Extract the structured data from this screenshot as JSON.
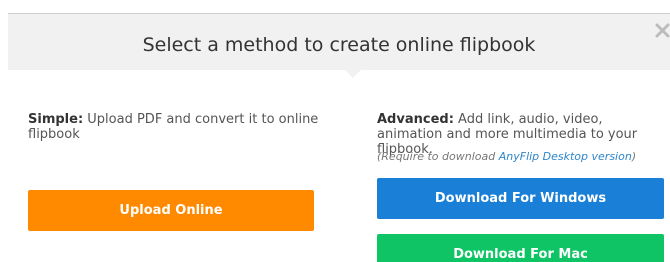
{
  "dialog": {
    "title": "Select a method to create online flipbook"
  },
  "simple": {
    "label": "Simple:",
    "text": " Upload PDF and convert it to online flipbook",
    "button_label": "Upload Online",
    "button_color": "#ff8a00"
  },
  "advanced": {
    "label": "Advanced:",
    "text": " Add link, audio, video, animation and more multimedia to your flipbook.",
    "note_prefix": "(Require to download ",
    "note_link": "AnyFlip Desktop version",
    "note_suffix": ")",
    "windows_button_label": "Download For Windows",
    "windows_button_color": "#1a7fd6",
    "mac_button_label": "Download For Mac",
    "mac_button_color": "#0ec464"
  },
  "icons": {
    "close": "close-icon"
  }
}
